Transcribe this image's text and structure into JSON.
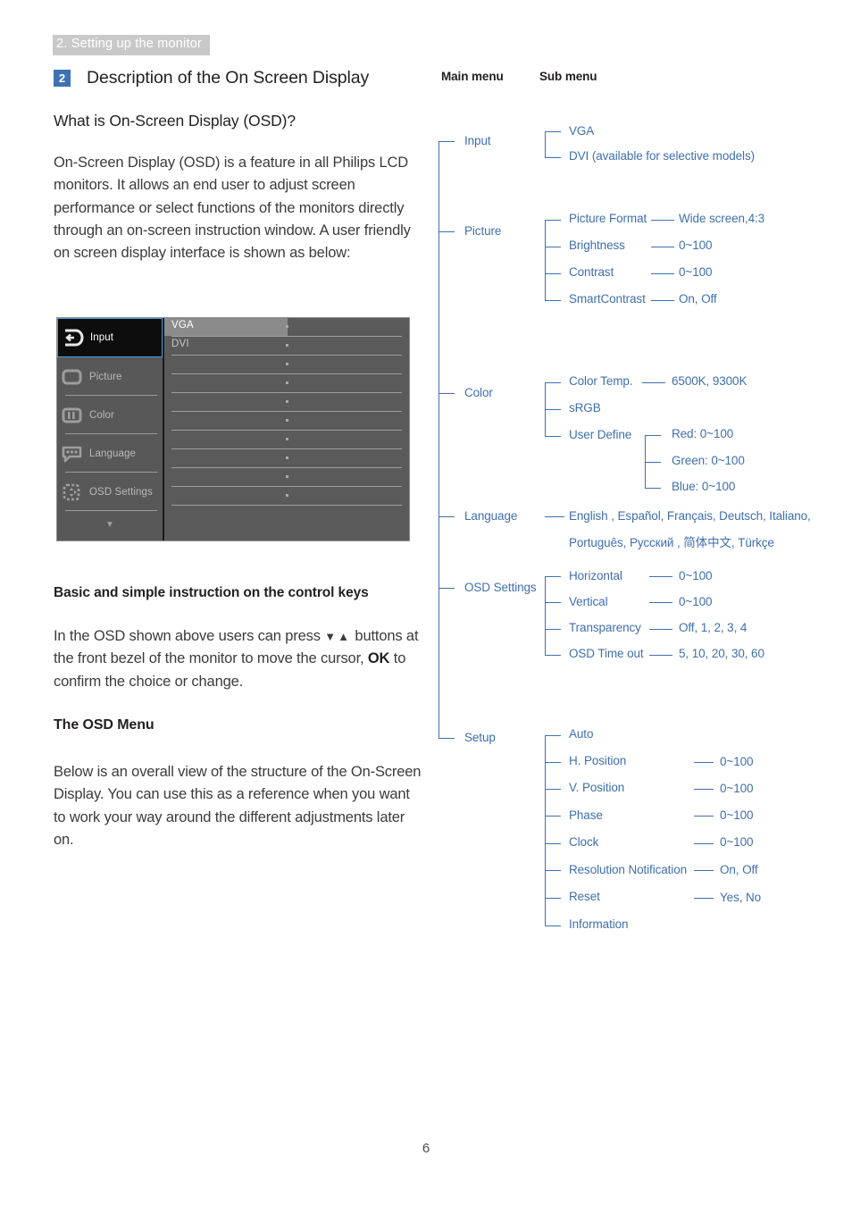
{
  "running_header": "2. Setting up the monitor",
  "section": {
    "badge": "2",
    "title": "Description of the On Screen Display"
  },
  "headings": {
    "what_is_osd": "What is On-Screen Display (OSD)?",
    "basic_instruction": "Basic and simple instruction on the control keys",
    "the_osd_menu": "The OSD Menu"
  },
  "paragraphs": {
    "intro": "On-Screen Display (OSD) is a feature in all Philips LCD monitors. It allows an end user to adjust screen performance or select functions of the monitors directly through an on-screen instruction window. A user friendly on screen display interface is shown as below:",
    "control_keys_1": "In the OSD shown above users can press",
    "control_keys_down": "▼",
    "control_keys_up": "▲",
    "control_keys_2": "buttons at the front bezel of the monitor to move the cursor,",
    "control_keys_ok": "OK",
    "control_keys_3": "to confirm the choice or change.",
    "osd_menu_body": "Below is an overall view of the structure of the On-Screen Display. You can use this as a reference when you want to work your way around the different adjustments later on."
  },
  "osd_screenshot": {
    "sidebar": [
      {
        "label": "Input",
        "icon": "input-arrow-icon",
        "selected": true
      },
      {
        "label": "Picture",
        "icon": "picture-frame-icon",
        "selected": false
      },
      {
        "label": "Color",
        "icon": "color-bars-icon",
        "selected": false
      },
      {
        "label": "Language",
        "icon": "speech-bubble-icon",
        "selected": false
      },
      {
        "label": "OSD Settings",
        "icon": "osd-position-icon",
        "selected": false
      }
    ],
    "scroll_down_glyph": "▼",
    "options": [
      {
        "label": "VGA",
        "highlighted": true
      },
      {
        "label": "DVI",
        "highlighted": false
      },
      {
        "label": "",
        "highlighted": false
      },
      {
        "label": "",
        "highlighted": false
      },
      {
        "label": "",
        "highlighted": false
      },
      {
        "label": "",
        "highlighted": false
      },
      {
        "label": "",
        "highlighted": false
      },
      {
        "label": "",
        "highlighted": false
      },
      {
        "label": "",
        "highlighted": false
      },
      {
        "label": "",
        "highlighted": false
      }
    ]
  },
  "tree": {
    "col_main": "Main menu",
    "col_sub": "Sub menu",
    "input": {
      "name": "Input",
      "children": [
        {
          "name": "VGA"
        },
        {
          "name": "DVI (available for selective models)"
        }
      ]
    },
    "picture": {
      "name": "Picture",
      "children": [
        {
          "name": "Picture Format",
          "value": "Wide screen,4:3"
        },
        {
          "name": "Brightness",
          "value": "0~100"
        },
        {
          "name": "Contrast",
          "value": "0~100"
        },
        {
          "name": "SmartContrast",
          "value": "On, Off"
        }
      ]
    },
    "color": {
      "name": "Color",
      "children": [
        {
          "name": "Color Temp.",
          "value": "6500K, 9300K"
        },
        {
          "name": "sRGB",
          "value": ""
        },
        {
          "name": "User Define",
          "value": ""
        }
      ],
      "user_define": [
        {
          "name": "Red: 0~100"
        },
        {
          "name": "Green: 0~100"
        },
        {
          "name": "Blue: 0~100"
        }
      ]
    },
    "language": {
      "name": "Language",
      "value_line1": "English , Español, Français, Deutsch, Italiano,",
      "value_line2": "Português, Русский , 简体中文, Türkçe"
    },
    "osd_settings": {
      "name": "OSD Settings",
      "children": [
        {
          "name": "Horizontal",
          "value": "0~100"
        },
        {
          "name": "Vertical",
          "value": "0~100"
        },
        {
          "name": "Transparency",
          "value": "Off, 1, 2, 3, 4"
        },
        {
          "name": "OSD Time out",
          "value": "5, 10, 20, 30, 60"
        }
      ]
    },
    "setup": {
      "name": "Setup",
      "children": [
        {
          "name": "Auto",
          "value": ""
        },
        {
          "name": "H. Position",
          "value": "0~100"
        },
        {
          "name": "V. Position",
          "value": "0~100"
        },
        {
          "name": "Phase",
          "value": "0~100"
        },
        {
          "name": "Clock",
          "value": "0~100"
        },
        {
          "name": "Resolution Notification",
          "value": "On, Off"
        },
        {
          "name": "Reset",
          "value": "Yes, No"
        },
        {
          "name": "Information",
          "value": ""
        }
      ]
    }
  },
  "page_number": "6"
}
